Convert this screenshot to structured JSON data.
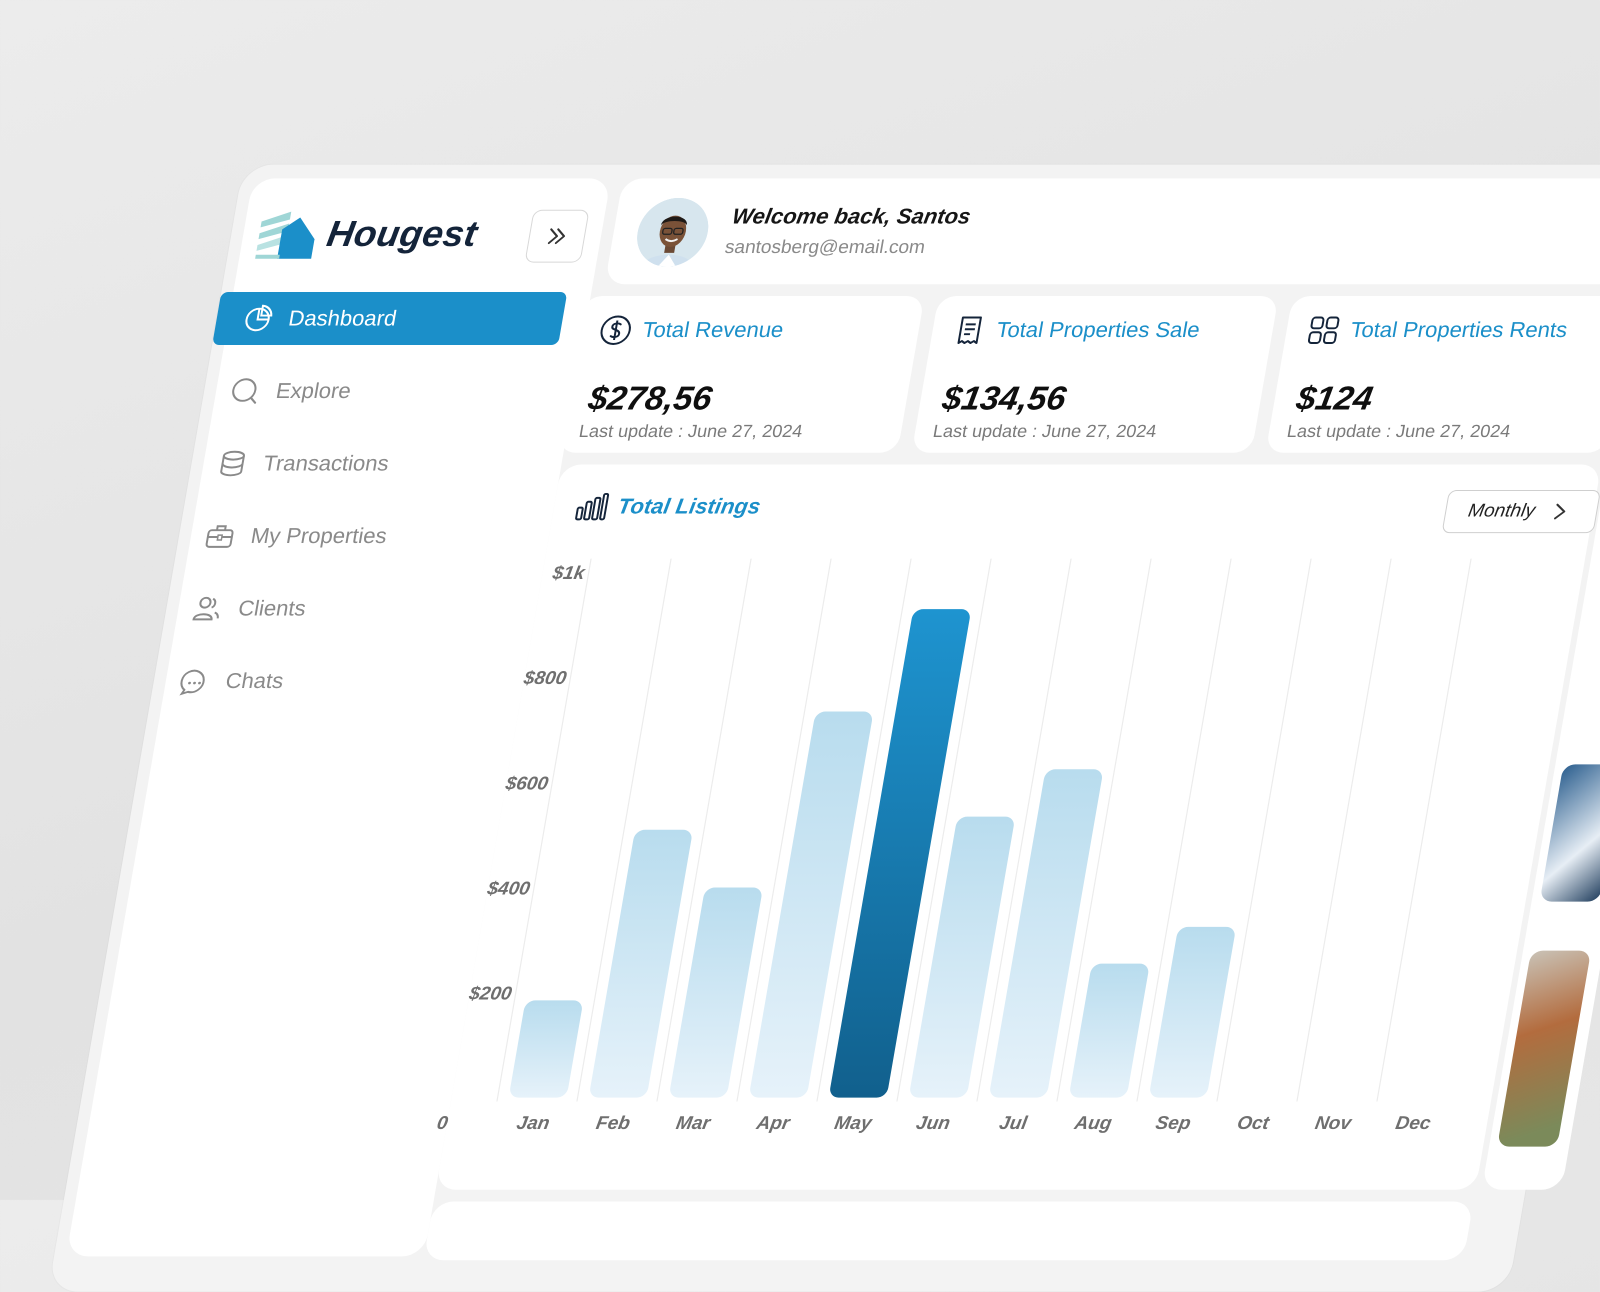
{
  "brand": {
    "name": "Hougest"
  },
  "sidebar": {
    "items": [
      {
        "label": "Dashboard",
        "icon": "pie-chart-icon",
        "active": true
      },
      {
        "label": "Explore",
        "icon": "search-icon",
        "active": false
      },
      {
        "label": "Transactions",
        "icon": "database-icon",
        "active": false
      },
      {
        "label": "My Properties",
        "icon": "briefcase-icon",
        "active": false
      },
      {
        "label": "Clients",
        "icon": "users-icon",
        "active": false
      },
      {
        "label": "Chats",
        "icon": "chat-icon",
        "active": false
      }
    ]
  },
  "header": {
    "welcome": "Welcome back, Santos",
    "email": "santosberg@email.com"
  },
  "stats": [
    {
      "title": "Total Revenue",
      "icon": "dollar-circle-icon",
      "value": "$278,56",
      "updated": "Last update : June 27, 2024"
    },
    {
      "title": "Total Properties Sale",
      "icon": "receipt-icon",
      "value": "$134,56",
      "updated": "Last update : June 27, 2024"
    },
    {
      "title": "Total Properties Rents",
      "icon": "grid-icon",
      "value": "$124",
      "updated": "Last update : June 27, 2024"
    }
  ],
  "listings": {
    "title": "Total Listings",
    "period": "Monthly"
  },
  "colors": {
    "accent": "#1b8fc9",
    "highlight_bar_top": "#1e94d0",
    "highlight_bar_bottom": "#11608d",
    "bar_top": "#b8dcee",
    "bar_bottom": "#e6f2fa"
  },
  "chart_data": {
    "type": "bar",
    "title": "Total Listings",
    "categories": [
      "Jan",
      "Feb",
      "Mar",
      "Apr",
      "May",
      "Jun",
      "Jul",
      "Aug",
      "Sep",
      "Oct",
      "Nov",
      "Dec"
    ],
    "values": [
      185,
      510,
      400,
      735,
      930,
      535,
      625,
      255,
      325,
      0,
      0,
      0
    ],
    "highlight_index": 4,
    "ylim": [
      0,
      1000
    ],
    "yticks": [
      {
        "value": 0,
        "label": "0"
      },
      {
        "value": 200,
        "label": "$200"
      },
      {
        "value": 400,
        "label": "$400"
      },
      {
        "value": 600,
        "label": "$600"
      },
      {
        "value": 800,
        "label": "$800"
      },
      {
        "value": 1000,
        "label": "$1k"
      }
    ],
    "grid": true
  }
}
